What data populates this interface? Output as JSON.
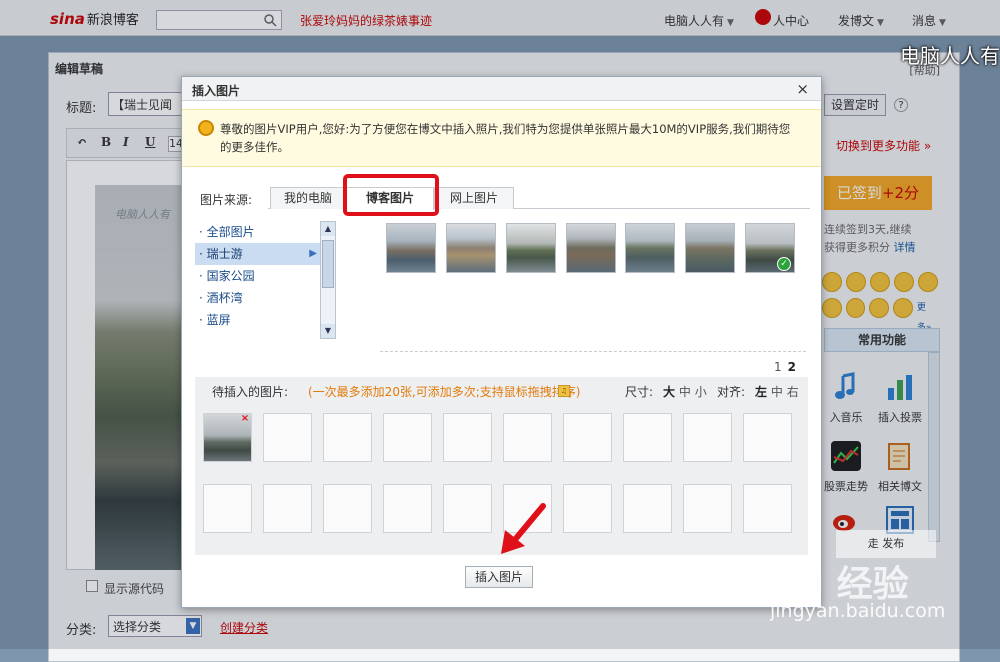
{
  "topbar": {
    "logo": "sina",
    "logo_suffix": "新浪博客",
    "search_placeholder": "",
    "headline_link": "张爱玲妈妈的绿茶婊事迹",
    "nav": [
      {
        "label": "电脑人人有",
        "caret": true
      },
      {
        "label": "人中心",
        "caret": false
      },
      {
        "label": "发博文",
        "caret": true
      },
      {
        "label": "消息",
        "caret": true
      }
    ]
  },
  "editor": {
    "header": "编辑草稿",
    "help": "[帮助]",
    "title_label": "标题:",
    "title_value": "【瑞士见闻",
    "font_size": "14",
    "watermark_text": "电脑人人有",
    "show_source": "显示源代码",
    "category_label": "分类:",
    "category_value": "选择分类",
    "create_category": "创建分类"
  },
  "right_panel": {
    "set_time": "设置定时",
    "help_q": "?",
    "more_functions": "切换到更多功能",
    "signed_in": "已签到",
    "signed_points": "+2分",
    "sign_text_1": "连续签到3天,继续",
    "sign_text_2": "获得更多积分",
    "sign_text_link": "详情",
    "more_emoji": "更多»",
    "common_functions": "常用功能",
    "funcs": [
      {
        "label": "入音乐",
        "icon": "music-note-icon",
        "color": "#2a7fd4"
      },
      {
        "label": "插入投票",
        "icon": "bar-chart-icon",
        "color": "#3aa050"
      },
      {
        "label": "股票走势",
        "icon": "stock-chart-icon",
        "color": "#1a1a1a"
      },
      {
        "label": "相关博文",
        "icon": "notepad-icon",
        "color": "#c86c1a"
      },
      {
        "label": "",
        "icon": "weibo-icon",
        "color": "#d81e06"
      },
      {
        "label": "",
        "icon": "layout-icon",
        "color": "#2a6db8"
      }
    ]
  },
  "modal": {
    "title": "插入图片",
    "close": "×",
    "vip_notice": "尊敬的图片VIP用户,您好:为了方便您在博文中插入照片,我们特为您提供单张照片最大10M的VIP服务,我们期待您的更多佳作。",
    "source_label": "图片来源:",
    "tabs": [
      {
        "label": "我的电脑",
        "active": false
      },
      {
        "label": "博客图片",
        "active": true
      },
      {
        "label": "网上图片",
        "active": false
      }
    ],
    "albums": [
      {
        "label": "全部图片",
        "selected": false
      },
      {
        "label": "瑞士游",
        "selected": true
      },
      {
        "label": "国家公园",
        "selected": false
      },
      {
        "label": "酒杯湾",
        "selected": false
      },
      {
        "label": "蓝屏",
        "selected": false
      }
    ],
    "thumbnail_count": 7,
    "selected_thumbnail": 7,
    "pager": {
      "pages": [
        "1",
        "2"
      ],
      "current": "2"
    },
    "pending": {
      "label": "待插入的图片:",
      "hint": "(一次最多添加20张,可添加多次;支持鼠标拖拽排序)",
      "size_label": "尺寸:",
      "size_options": [
        "大",
        "中",
        "小"
      ],
      "size_selected": "大",
      "align_label": "对齐:",
      "align_options": [
        "左",
        "中",
        "右"
      ],
      "align_selected": "左",
      "slots_total": 20,
      "slots_filled": 1
    },
    "insert_button": "插入图片"
  },
  "watermarks": {
    "top_right": "电脑人人有",
    "baidu_logo": "Bai 经验",
    "baidu_url": "jingyan.baidu.com",
    "mask_text": "走 发布"
  },
  "colors": {
    "highlight_box": "#e0101a",
    "arrow": "#e0101a",
    "link_red": "#c00",
    "hint_orange": "#e37a0a",
    "album_selected_bg": "#c9dcf2",
    "signed_bg": "#f5a623"
  }
}
